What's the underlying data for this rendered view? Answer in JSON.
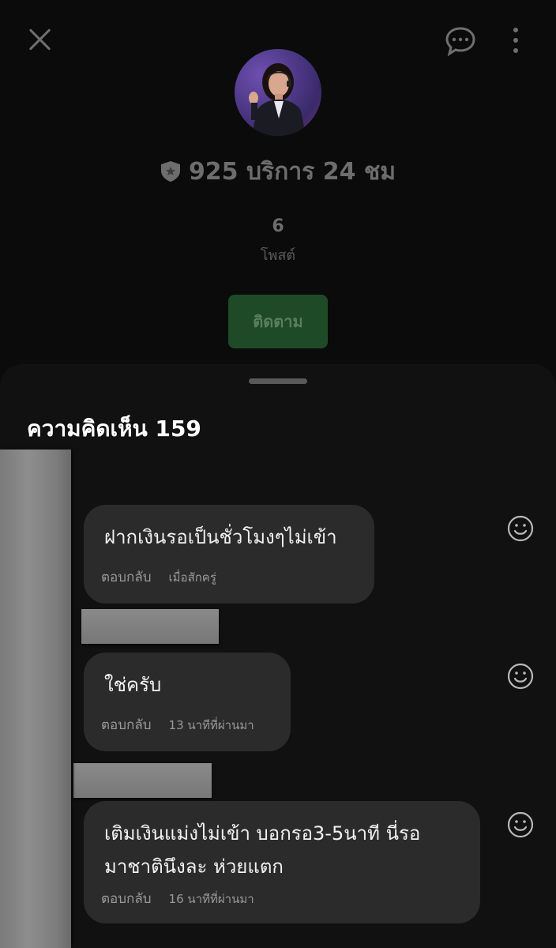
{
  "profile": {
    "display_name": "925 บริการ 24 ชม",
    "post_count": "6",
    "post_label": "โพสต์",
    "follow_label": "ติดตาม"
  },
  "comments_sheet": {
    "title": "ความคิดเห็น 159",
    "comments": [
      {
        "text_lines": [
          "ฝากเงินรอเป็นชั่วโมงๆไม่เข้า"
        ],
        "reply_label": "ตอบกลับ",
        "time": "เมื่อสักครู่"
      },
      {
        "text_lines": [
          "ใช่ครับ"
        ],
        "reply_label": "ตอบกลับ",
        "time": "13 นาทีที่ผ่านมา"
      },
      {
        "text_lines": [
          "เติมเงินแม่งไม่เข้า บอกรอ3-5นาที นี่รอ",
          "มาชาตินึงละ ห่วยแตก"
        ],
        "reply_label": "ตอบกลับ",
        "time": "16 นาทีที่ผ่านมา"
      }
    ]
  },
  "icons": {
    "close": "close-icon",
    "chat": "chat-bubble-icon",
    "more": "more-vertical-icon",
    "shield": "shield-star-icon",
    "reaction": "smiley-icon"
  },
  "colors": {
    "follow_button": "#1e4a27",
    "sheet_background": "#111111",
    "bubble_background": "#2b2b2b"
  }
}
